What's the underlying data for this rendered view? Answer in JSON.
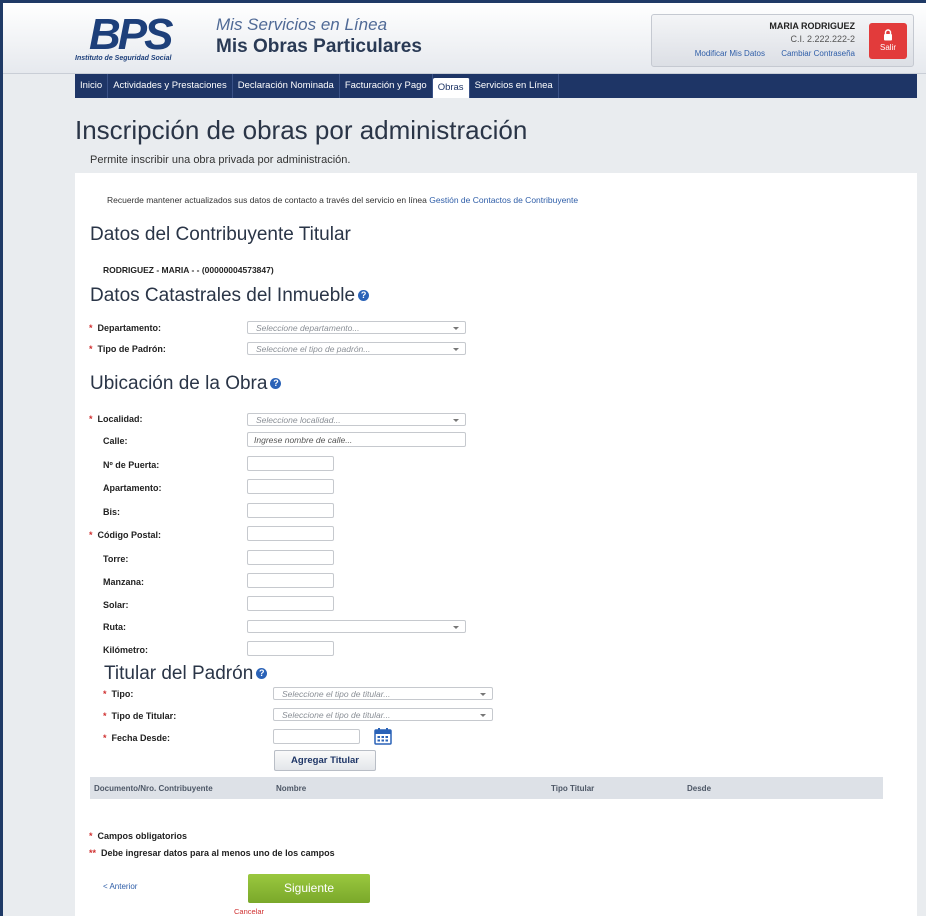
{
  "header": {
    "logo_text": "BPS",
    "logo_subtitle": "Instituto de Seguridad Social",
    "service_line1": "Mis Servicios en Línea",
    "service_line2": "Mis Obras Particulares",
    "user_name": "MARIA RODRIGUEZ",
    "user_ci": "C.I. 2.222.222-2",
    "modify_link": "Modificar Mis Datos",
    "password_link": "Cambiar Contraseña",
    "logout_label": "Salir"
  },
  "nav": {
    "tabs": [
      "Inicio",
      "Actividades y Prestaciones",
      "Declaración Nominada",
      "Facturación y Pago",
      "Obras",
      "Servicios en Línea"
    ],
    "active": "Obras"
  },
  "page": {
    "title": "Inscripción de obras por administración",
    "description": "Permite inscribir una obra privada por administración.",
    "notice_text": "Recuerde mantener actualizados sus datos de contacto a través del servicio en línea",
    "notice_link": "Gestión de Contactos de Contribuyente"
  },
  "titular": {
    "heading": "Datos del Contribuyente Titular",
    "value": "RODRIGUEZ - MARIA - - (00000004573847)"
  },
  "catastrales": {
    "heading": "Datos Catastrales del Inmueble",
    "departamento_label": "Departamento:",
    "departamento_placeholder": "Seleccione departamento...",
    "tipo_padron_label": "Tipo de Padrón:",
    "tipo_padron_placeholder": "Seleccione el tipo de padrón..."
  },
  "ubicacion": {
    "heading": "Ubicación de la Obra",
    "localidad_label": "Localidad:",
    "localidad_placeholder": "Seleccione localidad...",
    "calle_label": "Calle:",
    "calle_placeholder": "Ingrese nombre de calle...",
    "puerta_label": "Nº de Puerta:",
    "apartamento_label": "Apartamento:",
    "bis_label": "Bis:",
    "codigo_postal_label": "Código Postal:",
    "torre_label": "Torre:",
    "manzana_label": "Manzana:",
    "solar_label": "Solar:",
    "ruta_label": "Ruta:",
    "kilometro_label": "Kilómetro:"
  },
  "titular_padron": {
    "heading": "Titular del Padrón",
    "tipo_label": "Tipo:",
    "tipo_placeholder": "Seleccione el tipo de titular...",
    "tipo_titular_label": "Tipo de Titular:",
    "tipo_titular_placeholder": "Seleccione el tipo de titular...",
    "fecha_label": "Fecha Desde:",
    "add_button": "Agregar Titular",
    "columns": [
      "Documento/Nro. Contribuyente",
      "Nombre",
      "Tipo Titular",
      "Desde"
    ]
  },
  "footer": {
    "required_note": "Campos obligatorios",
    "one_of_note": "Debe ingresar datos para al menos uno de los campos",
    "prev_link": "< Anterior",
    "next_button": "Siguiente",
    "cancel_link": "Cancelar"
  }
}
